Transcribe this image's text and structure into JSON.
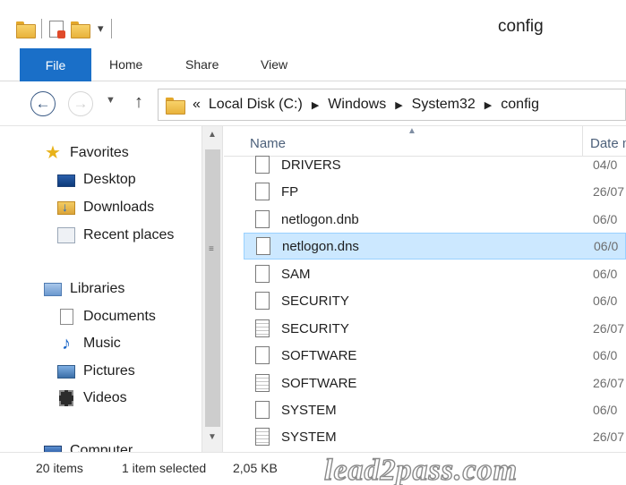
{
  "window": {
    "title": "config"
  },
  "ribbon": {
    "tabs": [
      "File",
      "Home",
      "Share",
      "View"
    ]
  },
  "address": {
    "segments": [
      "Local Disk (C:)",
      "Windows",
      "System32",
      "config"
    ],
    "overflow": "«"
  },
  "nav_pane": {
    "favorites": {
      "label": "Favorites",
      "items": [
        "Desktop",
        "Downloads",
        "Recent places"
      ]
    },
    "libraries": {
      "label": "Libraries",
      "items": [
        "Documents",
        "Music",
        "Pictures",
        "Videos"
      ]
    },
    "computer_label": "Computer"
  },
  "file_list": {
    "columns": {
      "name": "Name",
      "date": "Date m"
    },
    "rows": [
      {
        "name": "DRIVERS",
        "date": "04/0",
        "icon": "file-icon"
      },
      {
        "name": "FP",
        "date": "26/07",
        "icon": "file-icon"
      },
      {
        "name": "netlogon.dnb",
        "date": "06/0",
        "icon": "file-icon"
      },
      {
        "name": "netlogon.dns",
        "date": "06/0",
        "icon": "file-icon",
        "selected": true
      },
      {
        "name": "SAM",
        "date": "06/0",
        "icon": "file-icon"
      },
      {
        "name": "SECURITY",
        "date": "06/0",
        "icon": "file-icon"
      },
      {
        "name": "SECURITY",
        "date": "26/07",
        "icon": "lined-file-icon"
      },
      {
        "name": "SOFTWARE",
        "date": "06/0",
        "icon": "file-icon"
      },
      {
        "name": "SOFTWARE",
        "date": "26/07",
        "icon": "lined-file-icon"
      },
      {
        "name": "SYSTEM",
        "date": "06/0",
        "icon": "file-icon"
      },
      {
        "name": "SYSTEM",
        "date": "26/07",
        "icon": "lined-file-icon"
      }
    ]
  },
  "status": {
    "item_count": "20 items",
    "selection": "1 item selected",
    "size": "2,05 KB"
  },
  "watermark": "lead2pass.com",
  "colors": {
    "file_tab": "#1a6fc8",
    "selection_bg": "#cce8ff",
    "selection_border": "#99d1ff"
  }
}
